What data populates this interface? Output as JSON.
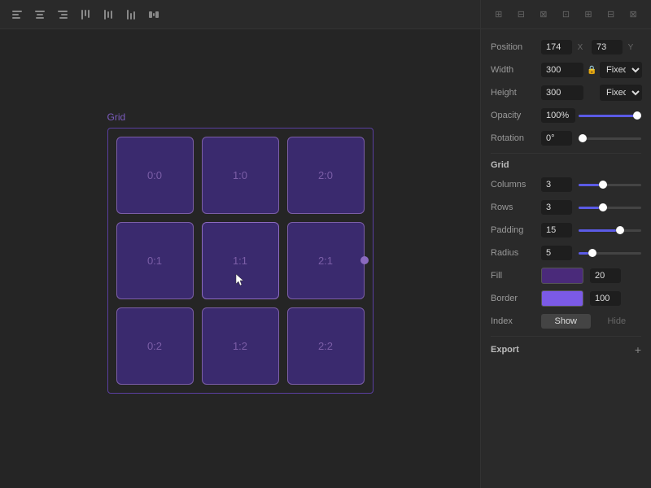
{
  "toolbar": {
    "icons": [
      "align-left-icon",
      "align-center-icon",
      "align-right-icon",
      "align-top-icon",
      "align-middle-icon",
      "align-bottom-icon",
      "distribute-icon"
    ]
  },
  "canvas": {
    "grid_label": "Grid",
    "cells": [
      "0:0",
      "1:0",
      "2:0",
      "0:1",
      "1:1",
      "2:1",
      "0:2",
      "1:2",
      "2:2"
    ],
    "active_cell": "1:1",
    "dot_cell": "2:1"
  },
  "panel": {
    "position_label": "Position",
    "position_x": "174",
    "position_x_label": "X",
    "position_y": "73",
    "position_y_label": "Y",
    "width_label": "Width",
    "width_value": "300",
    "width_mode": "Fixed",
    "height_label": "Height",
    "height_value": "300",
    "height_mode": "Fixed",
    "opacity_label": "Opacity",
    "opacity_value": "100%",
    "opacity_slider": 100,
    "rotation_label": "Rotation",
    "rotation_value": "0°",
    "rotation_slider": 0,
    "grid_section": "Grid",
    "columns_label": "Columns",
    "columns_value": "3",
    "columns_slider": 33,
    "rows_label": "Rows",
    "rows_value": "3",
    "rows_slider": 33,
    "padding_label": "Padding",
    "padding_value": "15",
    "padding_slider": 60,
    "radius_label": "Radius",
    "radius_value": "5",
    "radius_slider": 15,
    "fill_label": "Fill",
    "fill_value": "20",
    "border_label": "Border",
    "border_value": "100",
    "index_label": "Index",
    "index_show": "Show",
    "index_hide": "Hide",
    "export_label": "Export",
    "export_add": "+"
  }
}
